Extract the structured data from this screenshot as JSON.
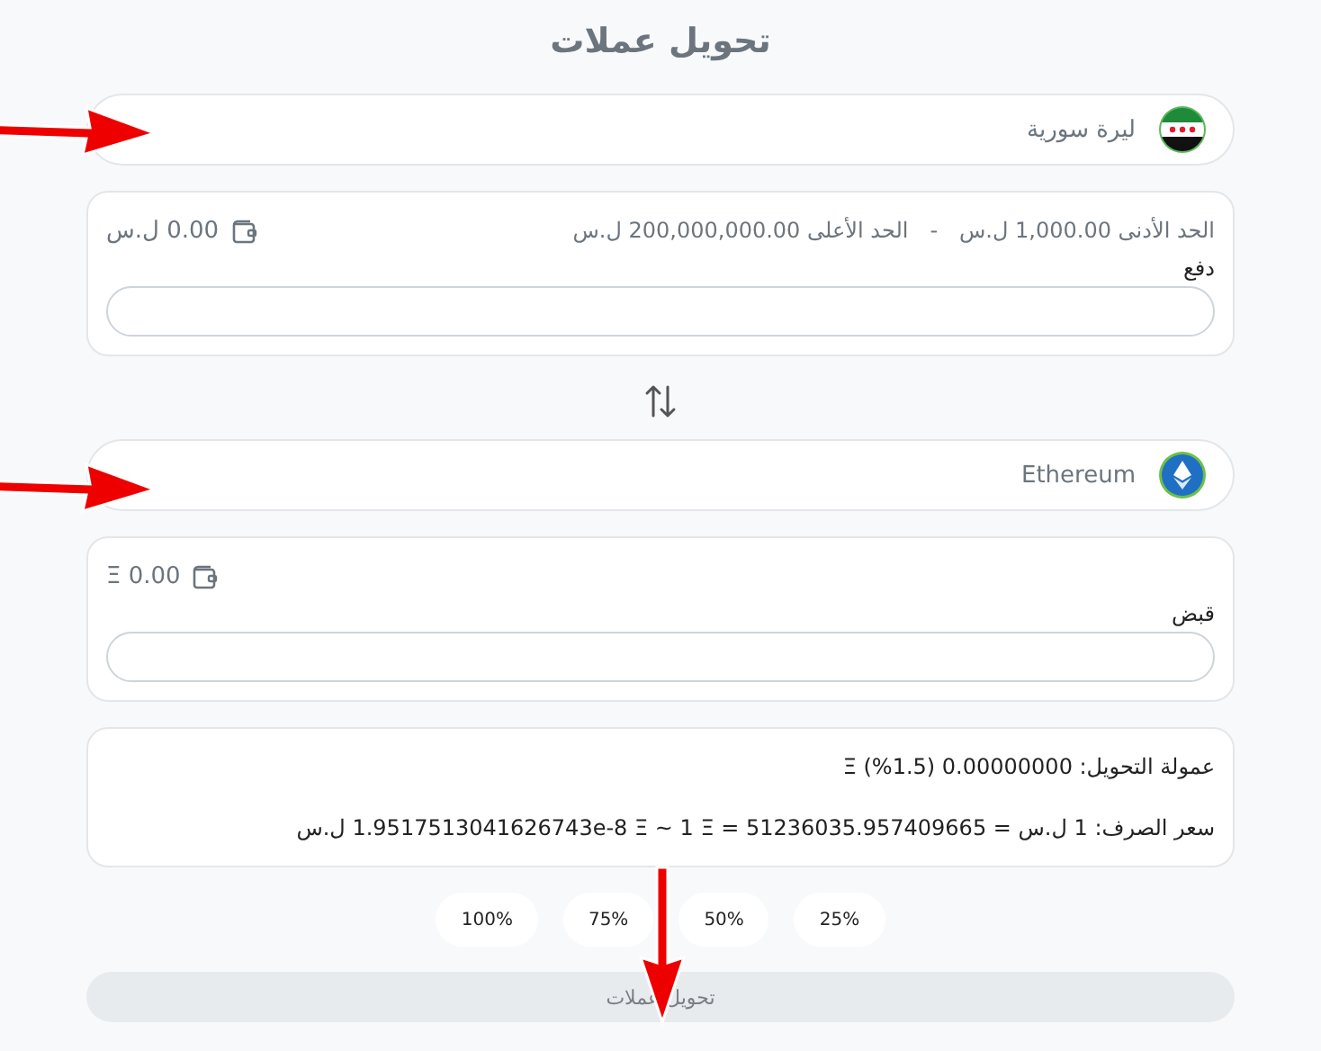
{
  "title": "تحويل عملات",
  "from": {
    "currency": "ليرة سورية",
    "kind": "flag",
    "balance": "0.00 ل.س",
    "min_label": "الحد الأدنى 1,000.00 ل.س",
    "separator": "-",
    "max_label": "الحد الأعلى 200,000,000.00 ل.س",
    "field_label": "دفع"
  },
  "to": {
    "currency": "Ethereum",
    "kind": "crypto",
    "balance": "0.00 Ξ",
    "field_label": "قبض"
  },
  "fee": "عمولة التحويل: 0.00000000 (1.5%) Ξ",
  "rate": "سعر الصرف: 1 ل.س = 1.9517513041626743e-8 Ξ ~ 1 Ξ = 51236035.957409665 ل.س",
  "percent_buttons": [
    "25%",
    "50%",
    "75%",
    "100%"
  ],
  "submit": {
    "label": "تحويل عملات",
    "disabled": true
  }
}
